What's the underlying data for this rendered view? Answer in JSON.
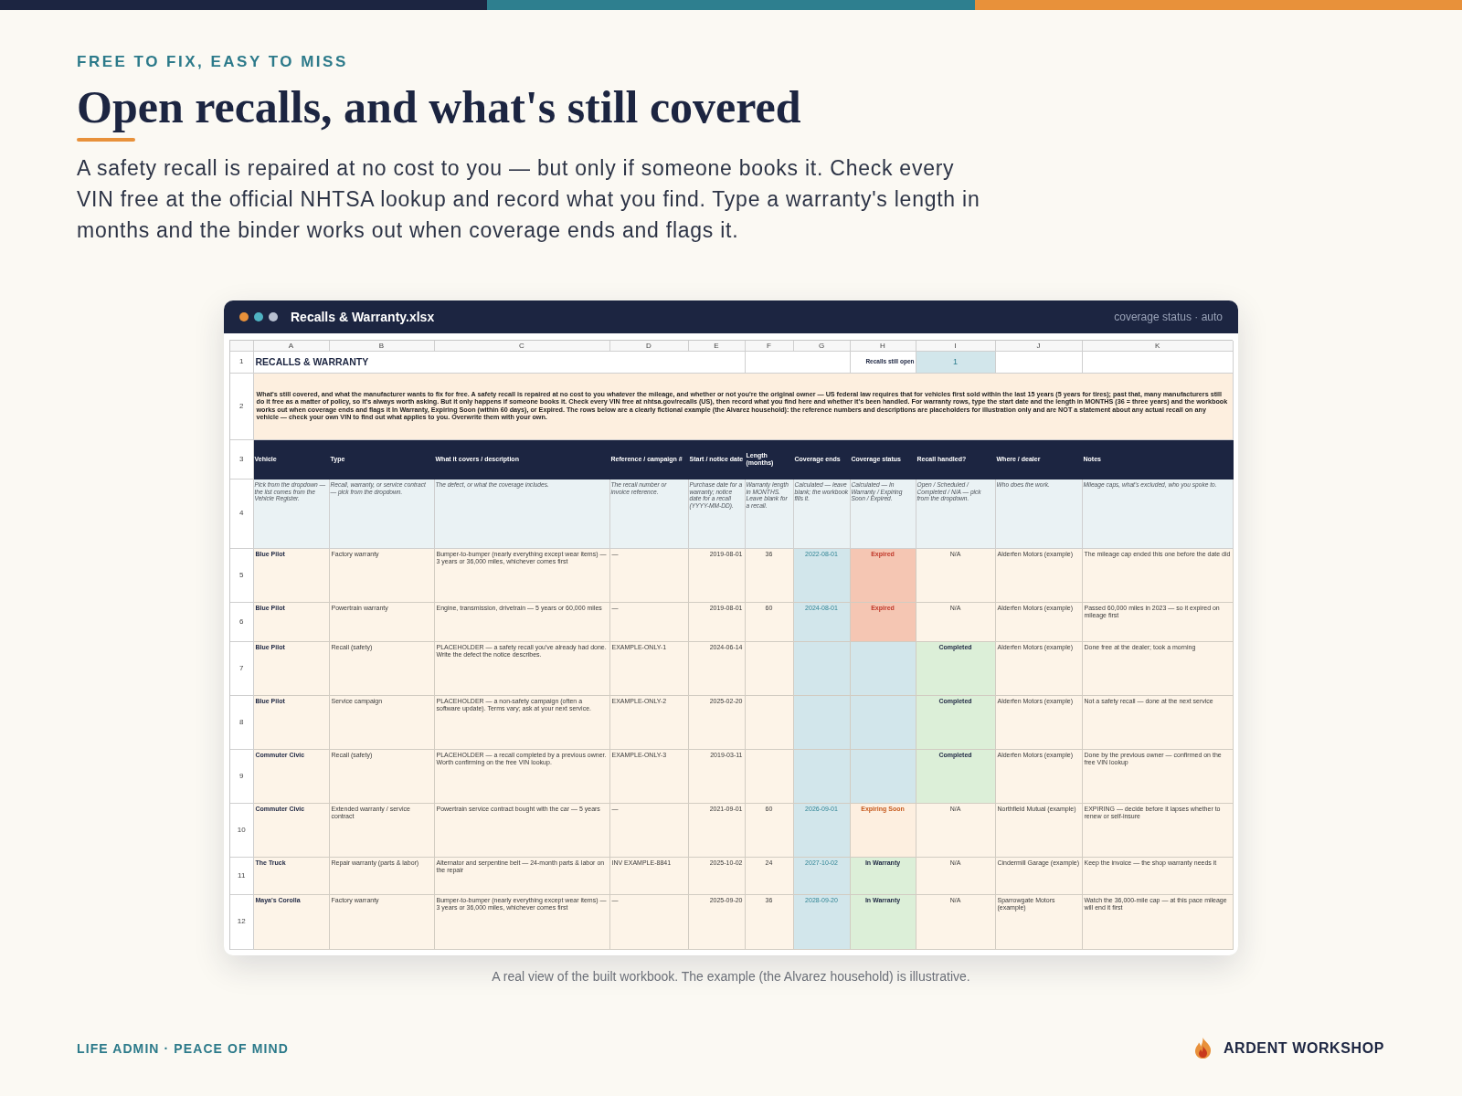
{
  "header": {
    "eyebrow": "FREE TO FIX, EASY TO MISS",
    "title": "Open recalls, and what's still covered",
    "intro": "A safety recall is repaired at no cost to you — but only if someone books it. Check every VIN free at the official NHTSA lookup and record what you find. Type a warranty's length in months and the binder works out when coverage ends and flags it."
  },
  "window": {
    "title": "Recalls & Warranty.xlsx",
    "status": "coverage status · auto"
  },
  "sheet": {
    "column_letters": [
      "A",
      "B",
      "C",
      "D",
      "E",
      "F",
      "G",
      "H",
      "I",
      "J",
      "K"
    ],
    "row_numbers": [
      "1",
      "2",
      "3",
      "4",
      "5",
      "6",
      "7",
      "8",
      "9",
      "10",
      "11",
      "12"
    ],
    "title": "RECALLS & WARRANTY",
    "summary": {
      "label": "Recalls still open",
      "value": "1"
    },
    "intro": "What's still covered, and what the manufacturer wants to fix for free. A safety recall is repaired at no cost to you whatever the mileage, and whether or not you're the original owner — US federal law requires that for vehicles first sold within the last 15 years (5 years for tires); past that, many manufacturers still do it free as a matter of policy, so it's always worth asking. But it only happens if someone books it. Check every VIN free at nhtsa.gov/recalls (US), then record what you find here and whether it's been handled. For warranty rows, type the start date and the length in MONTHS (36 = three years) and the workbook works out when coverage ends and flags it In Warranty, Expiring Soon (within 60 days), or Expired. The rows below are a clearly fictional example (the Alvarez household): the reference numbers and descriptions are placeholders for illustration only and are NOT a statement about any actual recall on any vehicle — check your own VIN to find out what applies to you. Overwrite them with your own.",
    "columns": [
      {
        "heading": "Vehicle",
        "hint": "Pick from the dropdown — the list comes from the Vehicle Register."
      },
      {
        "heading": "Type",
        "hint": "Recall, warranty, or service contract — pick from the dropdown."
      },
      {
        "heading": "What it covers / description",
        "hint": "The defect, or what the coverage includes."
      },
      {
        "heading": "Reference / campaign #",
        "hint": "The recall number or invoice reference."
      },
      {
        "heading": "Start / notice date",
        "hint": "Purchase date for a warranty; notice date for a recall (YYYY-MM-DD)."
      },
      {
        "heading": "Length (months)",
        "hint": "Warranty length in MONTHS. Leave blank for a recall."
      },
      {
        "heading": "Coverage ends",
        "hint": "Calculated — leave blank; the workbook fills it."
      },
      {
        "heading": "Coverage status",
        "hint": "Calculated — In Warranty / Expiring Soon / Expired."
      },
      {
        "heading": "Recall handled?",
        "hint": "Open / Scheduled / Completed / N/A — pick from the dropdown."
      },
      {
        "heading": "Where / dealer",
        "hint": "Who does the work."
      },
      {
        "heading": "Notes",
        "hint": "Mileage caps, what's excluded, who you spoke to."
      }
    ],
    "rows": [
      {
        "vehicle": "Blue Pilot",
        "type": "Factory warranty",
        "description": "Bumper-to-bumper (nearly everything except wear items) — 3 years or 36,000 miles, whichever comes first",
        "reference": "—",
        "start_date": "2019-08-01",
        "length_months": "36",
        "coverage_ends": "2022-08-01",
        "coverage_status": {
          "kind": "expired",
          "text": "Expired"
        },
        "recall_handled": {
          "kind": "na",
          "text": "N/A"
        },
        "where": "Alderfen Motors (example)",
        "notes": "The mileage cap ended this one before the date did"
      },
      {
        "vehicle": "Blue Pilot",
        "type": "Powertrain warranty",
        "description": "Engine, transmission, drivetrain — 5 years or 60,000 miles",
        "reference": "—",
        "start_date": "2019-08-01",
        "length_months": "60",
        "coverage_ends": "2024-08-01",
        "coverage_status": {
          "kind": "expired",
          "text": "Expired"
        },
        "recall_handled": {
          "kind": "na",
          "text": "N/A"
        },
        "where": "Alderfen Motors (example)",
        "notes": "Passed 60,000 miles in 2023 — so it expired on mileage first"
      },
      {
        "vehicle": "Blue Pilot",
        "type": "Recall (safety)",
        "description": "PLACEHOLDER — a safety recall you've already had done. Write the defect the notice describes.",
        "reference": "EXAMPLE-ONLY-1",
        "start_date": "2024-06-14",
        "coverage_status": {
          "kind": "blank"
        },
        "recall_handled": {
          "kind": "completed",
          "text": "Completed"
        },
        "where": "Alderfen Motors (example)",
        "notes": "Done free at the dealer; took a morning"
      },
      {
        "vehicle": "Blue Pilot",
        "type": "Service campaign",
        "description": "PLACEHOLDER — a non-safety campaign (often a software update). Terms vary; ask at your next service.",
        "reference": "EXAMPLE-ONLY-2",
        "start_date": "2025-02-20",
        "coverage_status": {
          "kind": "blank"
        },
        "recall_handled": {
          "kind": "completed",
          "text": "Completed"
        },
        "where": "Alderfen Motors (example)",
        "notes": "Not a safety recall — done at the next service"
      },
      {
        "vehicle": "Commuter Civic",
        "type": "Recall (safety)",
        "description": "PLACEHOLDER — a recall completed by a previous owner. Worth confirming on the free VIN lookup.",
        "reference": "EXAMPLE-ONLY-3",
        "start_date": "2019-03-11",
        "coverage_status": {
          "kind": "blank"
        },
        "recall_handled": {
          "kind": "completed",
          "text": "Completed"
        },
        "where": "Alderfen Motors (example)",
        "notes": "Done by the previous owner — confirmed on the free VIN lookup"
      },
      {
        "vehicle": "Commuter Civic",
        "type": "Extended warranty / service contract",
        "description": "Powertrain service contract bought with the car — 5 years",
        "reference": "—",
        "start_date": "2021-09-01",
        "length_months": "60",
        "coverage_ends": "2026-09-01",
        "coverage_status": {
          "kind": "expiring",
          "text": "Expiring Soon"
        },
        "recall_handled": {
          "kind": "na",
          "text": "N/A"
        },
        "where": "Northfield Mutual (example)",
        "notes": "EXPIRING — decide before it lapses whether to renew or self-insure"
      },
      {
        "vehicle": "The Truck",
        "type": "Repair warranty (parts & labor)",
        "description": "Alternator and serpentine belt — 24-month parts & labor on the repair",
        "reference": "INV EXAMPLE-8841",
        "start_date": "2025-10-02",
        "length_months": "24",
        "coverage_ends": "2027-10-02",
        "coverage_status": {
          "kind": "valid",
          "text": "In Warranty"
        },
        "recall_handled": {
          "kind": "na",
          "text": "N/A"
        },
        "where": "Cindermill Garage (example)",
        "notes": "Keep the invoice — the shop warranty needs it"
      },
      {
        "vehicle": "Maya's Corolla",
        "type": "Factory warranty",
        "description": "Bumper-to-bumper (nearly everything except wear items) — 3 years or 36,000 miles, whichever comes first",
        "reference": "—",
        "start_date": "2025-09-20",
        "length_months": "36",
        "coverage_ends": "2028-09-20",
        "coverage_status": {
          "kind": "valid",
          "text": "In Warranty"
        },
        "recall_handled": {
          "kind": "na",
          "text": "N/A"
        },
        "where": "Sparrowgate Motors (example)",
        "notes": "Watch the 36,000-mile cap — at this pace mileage will end it first"
      }
    ]
  },
  "caption": "A real view of the built workbook. The example (the Alvarez household) is illustrative.",
  "footer": {
    "tagline": "LIFE ADMIN · PEACE OF MIND",
    "brand": "ARDENT WORKSHOP"
  }
}
